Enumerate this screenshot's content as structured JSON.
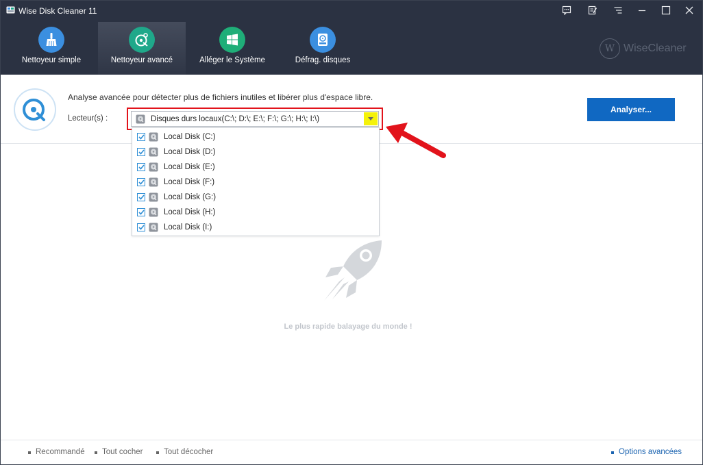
{
  "window": {
    "title": "Wise Disk Cleaner 11"
  },
  "titlebar_buttons": [
    "feedback-icon",
    "notes-icon",
    "menu-icon",
    "minimize-icon",
    "maximize-icon",
    "close-icon"
  ],
  "tabs": [
    {
      "label": "Nettoyeur simple",
      "icon": "broom-icon",
      "color": "#3b8fe0",
      "active": false
    },
    {
      "label": "Nettoyeur avancé",
      "icon": "disk-scan-icon",
      "color": "#1fa88a",
      "active": true
    },
    {
      "label": "Alléger le Système",
      "icon": "windows-icon",
      "color": "#1fae78",
      "active": false
    },
    {
      "label": "Défrag. disques",
      "icon": "defrag-disk-icon",
      "color": "#3b8fe0",
      "active": false
    }
  ],
  "brand": {
    "name": "WiseCleaner",
    "logo_letter": "W"
  },
  "info": {
    "description": "Analyse avancée pour détecter plus de fichiers inutiles et libérer plus d'espace libre.",
    "drives_label": "Lecteur(s) :",
    "selected_value": "Disques durs locaux(C:\\; D:\\; E:\\; F:\\; G:\\; H:\\; I:\\)",
    "analyze_label": "Analyser..."
  },
  "drives": [
    {
      "label": "Local Disk (C:)",
      "checked": true
    },
    {
      "label": "Local Disk (D:)",
      "checked": true
    },
    {
      "label": "Local Disk (E:)",
      "checked": true
    },
    {
      "label": "Local Disk (F:)",
      "checked": true
    },
    {
      "label": "Local Disk (G:)",
      "checked": true
    },
    {
      "label": "Local Disk (H:)",
      "checked": true
    },
    {
      "label": "Local Disk (I:)",
      "checked": true
    }
  ],
  "empty_state": {
    "tagline": "Le plus rapide balayage du monde !"
  },
  "footer": {
    "recommended": "Recommandé",
    "check_all": "Tout cocher",
    "uncheck_all": "Tout décocher",
    "advanced_options": "Options avancées"
  },
  "colors": {
    "header_bg": "#2b3242",
    "accent_blue": "#1068c2",
    "highlight_red": "#e2131b",
    "dropdown_button": "#f5f20a"
  }
}
